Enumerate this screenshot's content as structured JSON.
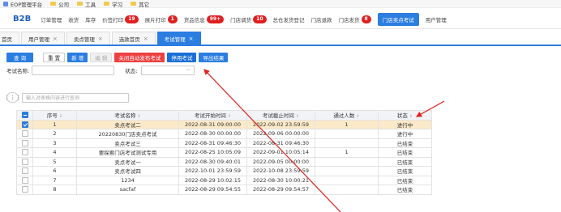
{
  "bookmarks": [
    {
      "label": "EOP管理平台",
      "icon": "page-icon"
    },
    {
      "label": "公司",
      "icon": "folder-icon"
    },
    {
      "label": "工具",
      "icon": "folder-icon"
    },
    {
      "label": "学习",
      "icon": "folder-icon"
    },
    {
      "label": "其它",
      "icon": "folder-icon"
    }
  ],
  "nav": {
    "brand": "B2B",
    "items": [
      {
        "label": "订单管理",
        "badge": ""
      },
      {
        "label": "收货",
        "badge": ""
      },
      {
        "label": "库存",
        "badge": ""
      },
      {
        "label": "价签打印",
        "badge": "19"
      },
      {
        "label": "展片打印",
        "badge": "1"
      },
      {
        "label": "货品信息",
        "badge": "99+"
      },
      {
        "label": "门店调货",
        "badge": "10"
      },
      {
        "label": "总仓发货登记",
        "badge": ""
      },
      {
        "label": "门店退款",
        "badge": ""
      },
      {
        "label": "门店发货",
        "badge": "8"
      },
      {
        "label": "门店卖点考试",
        "badge": "",
        "active": true
      },
      {
        "label": "用户管理",
        "badge": ""
      }
    ],
    "badge_color": "#e02020",
    "active_color": "#2b7de0"
  },
  "tabs": [
    {
      "label": "首页",
      "closable": false
    },
    {
      "label": "用户管理",
      "closable": true
    },
    {
      "label": "卖点管理",
      "closable": true
    },
    {
      "label": "选款首页",
      "closable": true
    },
    {
      "label": "考试管理",
      "closable": true,
      "active": true
    }
  ],
  "toolbar": {
    "query": "查 询",
    "reset": "重 置",
    "add": "新 增",
    "edit": "编 辑",
    "close_auto_publish": "关闭自动发布考试",
    "disable_exam": "停用考试",
    "export": "导出结果"
  },
  "filters": {
    "exam_name_label": "考试名称:",
    "exam_name_value": "",
    "status_label": "状态:",
    "status_value": ""
  },
  "table_search": {
    "placeholder": "输入对表格内容进行查询",
    "columns_icon": "columns-icon"
  },
  "table": {
    "headers": [
      "序号",
      "考试名称",
      "考试开始时间",
      "考试截止时间",
      "通过人数",
      "状态"
    ],
    "rows": [
      {
        "checked": true,
        "no": "1",
        "name": "卖点考试二",
        "start": "2022-08-31 09:00:00",
        "end": "2022-09-02 23:59:59",
        "passed": "1",
        "status": "进行中"
      },
      {
        "checked": false,
        "no": "2",
        "name": "20220830门店卖点考试",
        "start": "2022-08-30 00:00:00",
        "end": "2022-09-06 00:00:00",
        "passed": "",
        "status": "进行中"
      },
      {
        "checked": false,
        "no": "3",
        "name": "卖点考试三",
        "start": "2022-08-31 09:46:30",
        "end": "2022-08-31 09:46:30",
        "passed": "",
        "status": "已结束"
      },
      {
        "checked": false,
        "no": "4",
        "name": "要探索门店考试测试专用",
        "start": "2022-08-25 10:05:09",
        "end": "2022-09-01 10:05:14",
        "passed": "1",
        "status": "已结束"
      },
      {
        "checked": false,
        "no": "5",
        "name": "卖点考试一",
        "start": "2022-08-30 09:40:01",
        "end": "2022-09-05 00:00:00",
        "passed": "",
        "status": "已结束"
      },
      {
        "checked": false,
        "no": "6",
        "name": "卖点考试四",
        "start": "2022-10-01 23:59:59",
        "end": "2022-10-08 23:59:59",
        "passed": "",
        "status": "已结束"
      },
      {
        "checked": false,
        "no": "7",
        "name": "1234",
        "start": "2022-08-29 10:02:15",
        "end": "2022-08-30 10:00:21",
        "passed": "",
        "status": "已结束"
      },
      {
        "checked": false,
        "no": "8",
        "name": "sacfaf",
        "start": "2022-08-29 09:54:55",
        "end": "2022-08-29 09:54:57",
        "passed": "",
        "status": "已结束"
      }
    ],
    "selected_row_color": "#fbe9c8"
  },
  "annotations": {
    "arrow_color": "#e0201e"
  }
}
